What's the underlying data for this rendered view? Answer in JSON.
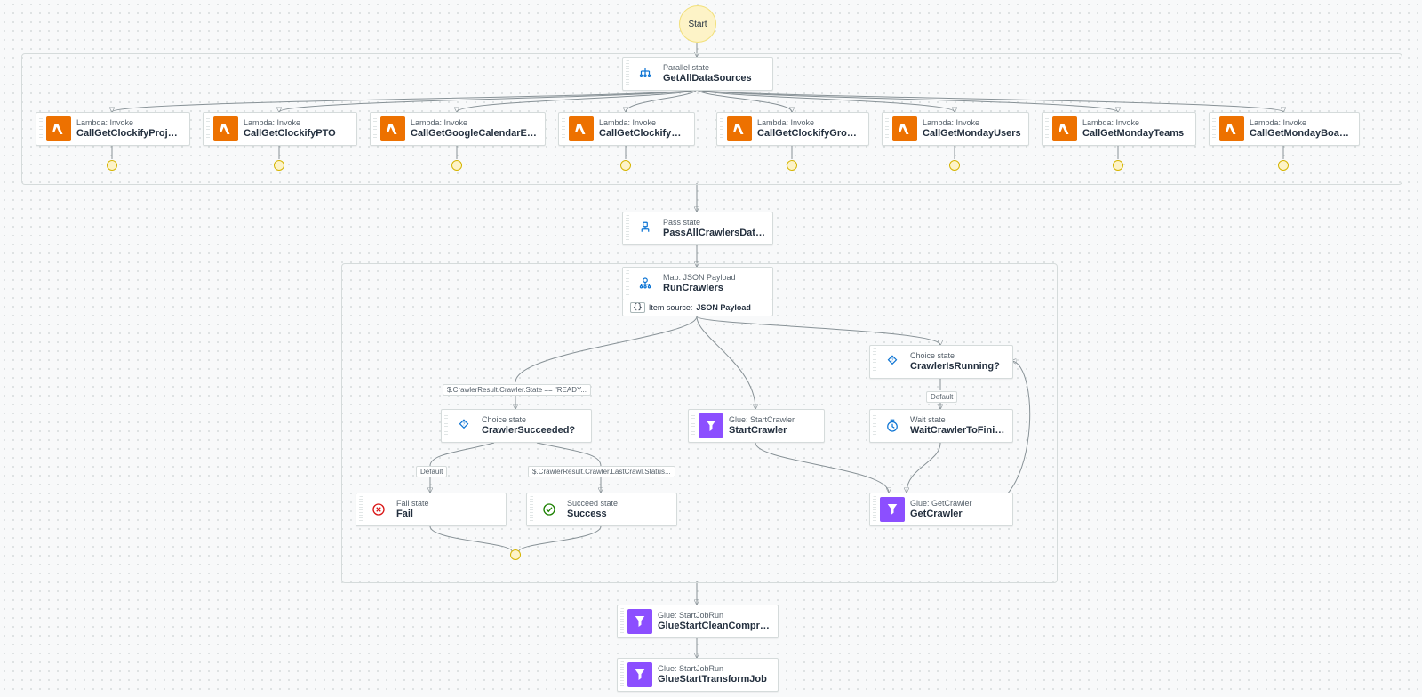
{
  "start_label": "Start",
  "group_parallel": {
    "type": "Parallel state",
    "name": "GetAllDataSources"
  },
  "lambdas": [
    {
      "type": "Lambda: Invoke",
      "name": "CallGetClockifyProjects"
    },
    {
      "type": "Lambda: Invoke",
      "name": "CallGetClockifyPTO"
    },
    {
      "type": "Lambda: Invoke",
      "name": "CallGetGoogleCalendarEvents"
    },
    {
      "type": "Lambda: Invoke",
      "name": "CallGetClockifyUsers"
    },
    {
      "type": "Lambda: Invoke",
      "name": "CallGetClockifyGroups"
    },
    {
      "type": "Lambda: Invoke",
      "name": "CallGetMondayUsers"
    },
    {
      "type": "Lambda: Invoke",
      "name": "CallGetMondayTeams"
    },
    {
      "type": "Lambda: Invoke",
      "name": "CallGetMondayBoards"
    }
  ],
  "pass": {
    "type": "Pass state",
    "name": "PassAllCrawlersDatasets"
  },
  "map": {
    "type": "Map: JSON Payload",
    "name": "RunCrawlers",
    "item_source_label": "Item source:",
    "item_source_value": "JSON Payload"
  },
  "choice_ready": {
    "type": "Choice state",
    "name": "CrawlerSucceeded?"
  },
  "choice_running": {
    "type": "Choice state",
    "name": "CrawlerIsRunning?"
  },
  "wait": {
    "type": "Wait state",
    "name": "WaitCrawlerToFinish"
  },
  "start_crawler": {
    "type": "Glue: StartCrawler",
    "name": "StartCrawler"
  },
  "get_crawler": {
    "type": "Glue: GetCrawler",
    "name": "GetCrawler"
  },
  "fail": {
    "type": "Fail state",
    "name": "Fail"
  },
  "success": {
    "type": "Succeed state",
    "name": "Success"
  },
  "glue_clean": {
    "type": "Glue: StartJobRun",
    "name": "GlueStartCleanCompressJob"
  },
  "glue_transform": {
    "type": "Glue: StartJobRun",
    "name": "GlueStartTransformJob"
  },
  "cond_ready": "$.CrawlerResult.Crawler.State == \"READY...",
  "cond_default": "Default",
  "cond_lastcrawl": "$.CrawlerResult.Crawler.LastCrawl.Status..."
}
